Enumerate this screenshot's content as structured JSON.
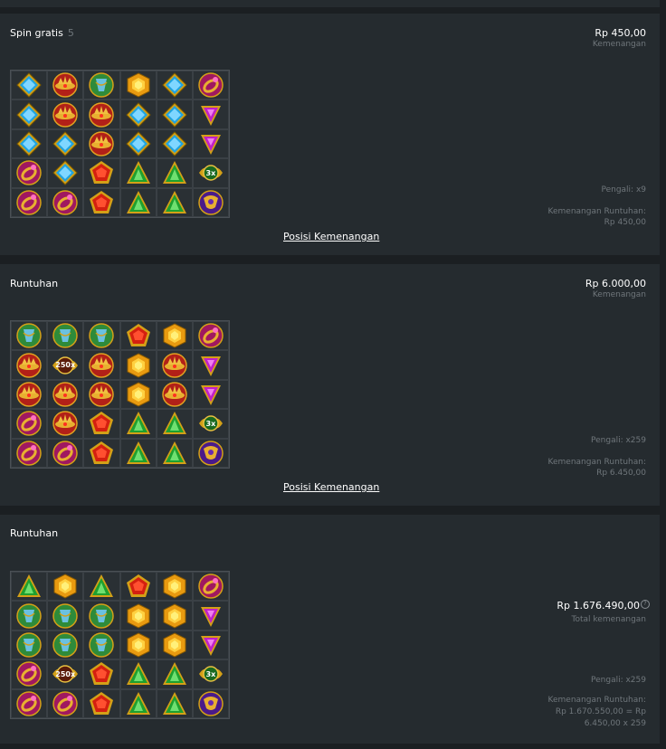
{
  "panels": [
    {
      "title": "Spin gratis",
      "count": "5",
      "amount": "Rp 450,00",
      "amount_label": "Kemenangan",
      "multiplier": "Pengali: x9",
      "cascade_label": "Kemenangan Runtuhan:",
      "cascade_value": "Rp 450,00",
      "link": "Posisi Kemenangan",
      "grid": [
        [
          "blue-diamond",
          "red-crown",
          "green-blue-orb",
          "gold-hexagon",
          "blue-diamond",
          "pink-ring"
        ],
        [
          "blue-diamond",
          "red-crown",
          "red-crown",
          "blue-diamond",
          "blue-diamond",
          "purple-triangle"
        ],
        [
          "blue-diamond",
          "blue-diamond",
          "red-crown",
          "blue-diamond",
          "blue-diamond",
          "purple-triangle"
        ],
        [
          "pink-ring",
          "blue-diamond",
          "red-pentagon",
          "green-triangle",
          "green-triangle",
          "multiplier-3x"
        ],
        [
          "pink-ring",
          "pink-ring",
          "red-pentagon",
          "green-triangle",
          "green-triangle",
          "purple-scarab"
        ]
      ]
    },
    {
      "title": "Runtuhan",
      "amount": "Rp 6.000,00",
      "amount_label": "Kemenangan",
      "multiplier": "Pengali: x259",
      "cascade_label": "Kemenangan Runtuhan:",
      "cascade_value": "Rp 6.450,00",
      "link": "Posisi Kemenangan",
      "grid": [
        [
          "green-blue-orb",
          "green-blue-orb",
          "green-blue-orb",
          "red-pentagon",
          "gold-hexagon",
          "pink-ring"
        ],
        [
          "red-crown",
          "multiplier-250x",
          "red-crown",
          "gold-hexagon",
          "red-crown",
          "purple-triangle"
        ],
        [
          "red-crown",
          "red-crown",
          "red-crown",
          "gold-hexagon",
          "red-crown",
          "purple-triangle"
        ],
        [
          "pink-ring",
          "red-crown",
          "red-pentagon",
          "green-triangle",
          "green-triangle",
          "multiplier-3x"
        ],
        [
          "pink-ring",
          "pink-ring",
          "red-pentagon",
          "green-triangle",
          "green-triangle",
          "purple-scarab"
        ]
      ]
    },
    {
      "title": "Runtuhan",
      "amount": "Rp 1.676.490,00",
      "amount_label": "Total kemenangan",
      "help_icon": "question-icon",
      "multiplier": "Pengali: x259",
      "cascade_label": "Kemenangan Runtuhan:",
      "cascade_value_line1": "Rp 1.670.550,00 = Rp",
      "cascade_value_line2": "6.450,00 x 259",
      "grid": [
        [
          "green-triangle",
          "gold-hexagon",
          "green-triangle",
          "red-pentagon",
          "gold-hexagon",
          "pink-ring"
        ],
        [
          "green-blue-orb",
          "green-blue-orb",
          "green-blue-orb",
          "gold-hexagon",
          "gold-hexagon",
          "purple-triangle"
        ],
        [
          "green-blue-orb",
          "green-blue-orb",
          "green-blue-orb",
          "gold-hexagon",
          "gold-hexagon",
          "purple-triangle"
        ],
        [
          "pink-ring",
          "multiplier-250x",
          "red-pentagon",
          "green-triangle",
          "green-triangle",
          "multiplier-3x"
        ],
        [
          "pink-ring",
          "pink-ring",
          "red-pentagon",
          "green-triangle",
          "green-triangle",
          "purple-scarab"
        ]
      ]
    }
  ],
  "multiplier_labels": {
    "multiplier-250x": "250x",
    "multiplier-3x": "3x"
  }
}
